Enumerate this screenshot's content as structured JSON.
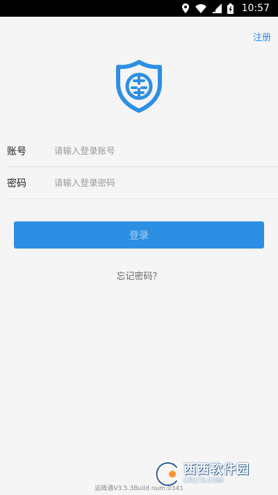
{
  "status_bar": {
    "time": "10:57",
    "icons": [
      "location-icon",
      "wifi-icon",
      "signal-icon",
      "battery-charging-icon"
    ]
  },
  "header": {
    "register_label": "注册"
  },
  "logo": {
    "icon": "shield-logo-icon",
    "color": "#2d8fe3"
  },
  "form": {
    "account_label": "账号",
    "account_placeholder": "请输入登录账号",
    "account_value": "",
    "password_label": "密码",
    "password_placeholder": "请输入登录密码",
    "password_value": ""
  },
  "login_button_label": "登录",
  "forgot_password_label": "忘记密码？",
  "version_text": "运政通V3.5.3Build num:0341",
  "watermark": {
    "main": "西西软件园",
    "sub": "CR173.COM"
  },
  "colors": {
    "accent": "#2d8fe3",
    "background": "#f5f5f5",
    "status_bar": "#000000"
  }
}
